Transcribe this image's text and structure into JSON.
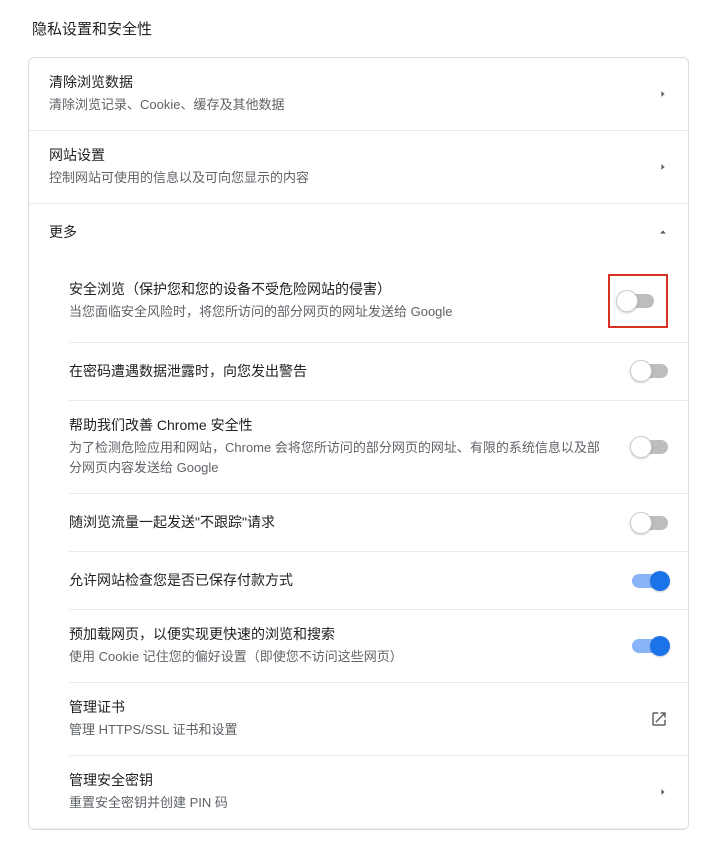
{
  "page": {
    "title": "隐私设置和安全性"
  },
  "top_rows": [
    {
      "id": "clear-browsing-data",
      "title": "清除浏览数据",
      "desc": "清除浏览记录、Cookie、缓存及其他数据"
    },
    {
      "id": "site-settings",
      "title": "网站设置",
      "desc": "控制网站可使用的信息以及可向您显示的内容"
    }
  ],
  "more": {
    "label": "更多",
    "expanded": true,
    "items": [
      {
        "id": "safe-browsing",
        "title": "安全浏览（保护您和您的设备不受危险网站的侵害）",
        "desc": "当您面临安全风险时，将您所访问的部分网页的网址发送给 Google",
        "control": "toggle",
        "state": "off",
        "highlight": true
      },
      {
        "id": "password-leak-warning",
        "title": "在密码遭遇数据泄露时，向您发出警告",
        "desc": "",
        "control": "toggle",
        "state": "off"
      },
      {
        "id": "help-improve-security",
        "title": "帮助我们改善 Chrome 安全性",
        "desc": "为了检测危险应用和网站，Chrome 会将您所访问的部分网页的网址、有限的系统信息以及部分网页内容发送给 Google",
        "control": "toggle",
        "state": "off"
      },
      {
        "id": "do-not-track",
        "title": "随浏览流量一起发送\"不跟踪\"请求",
        "desc": "",
        "control": "toggle",
        "state": "off"
      },
      {
        "id": "payment-check",
        "title": "允许网站检查您是否已保存付款方式",
        "desc": "",
        "control": "toggle",
        "state": "on"
      },
      {
        "id": "preload-pages",
        "title": "预加载网页，以便实现更快速的浏览和搜索",
        "desc": "使用 Cookie 记住您的偏好设置（即使您不访问这些网页）",
        "control": "toggle",
        "state": "on"
      },
      {
        "id": "manage-certs",
        "title": "管理证书",
        "desc": "管理 HTTPS/SSL 证书和设置",
        "control": "external"
      },
      {
        "id": "manage-security-keys",
        "title": "管理安全密钥",
        "desc": "重置安全密钥并创建 PIN 码",
        "control": "chevron"
      }
    ]
  }
}
